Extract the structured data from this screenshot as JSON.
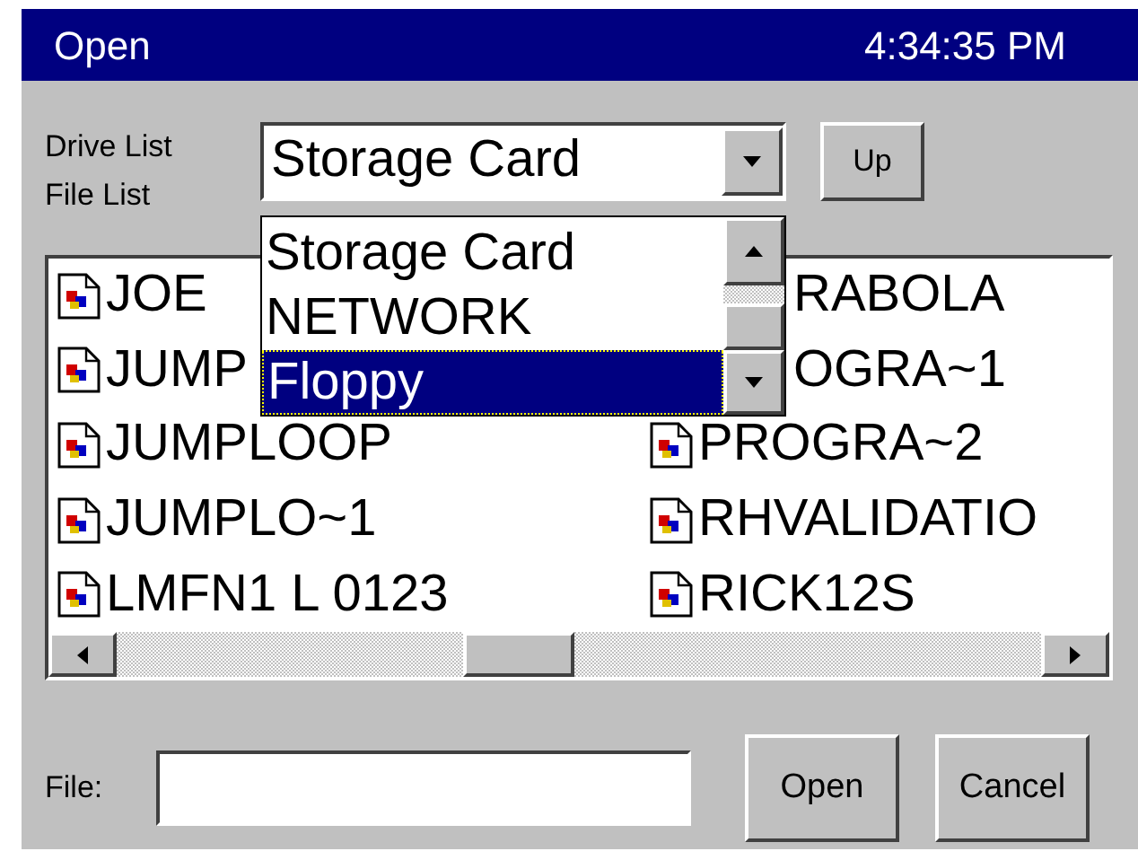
{
  "window": {
    "title": "Open",
    "clock": "4:34:35 PM"
  },
  "drive_list": {
    "label": "Drive List",
    "value": "Storage Card",
    "expanded": true,
    "options": [
      {
        "label": "Storage Card",
        "highlighted": false
      },
      {
        "label": "NETWORK",
        "highlighted": false
      },
      {
        "label": "Floppy",
        "highlighted": true
      }
    ]
  },
  "up_button": "Up",
  "file_list": {
    "label": "File List",
    "columns": [
      [
        {
          "name": "JOE",
          "kind": "file"
        },
        {
          "name": "JUMP",
          "kind": "file"
        },
        {
          "name": "JUMPLOOP",
          "kind": "file"
        },
        {
          "name": "JUMPLO~1",
          "kind": "file"
        },
        {
          "name": "LMFN1 L 0123",
          "kind": "file"
        }
      ],
      [
        {
          "name": "RABOLA",
          "kind": "partial"
        },
        {
          "name": "OGRA~1",
          "kind": "partial"
        },
        {
          "name": "PROGRA~2",
          "kind": "file"
        },
        {
          "name": "RHVALIDATIO",
          "kind": "file"
        },
        {
          "name": "RICK12S",
          "kind": "file"
        }
      ]
    ]
  },
  "file_field": {
    "label": "File:"
  },
  "buttons": [
    "Open",
    "Cancel"
  ]
}
